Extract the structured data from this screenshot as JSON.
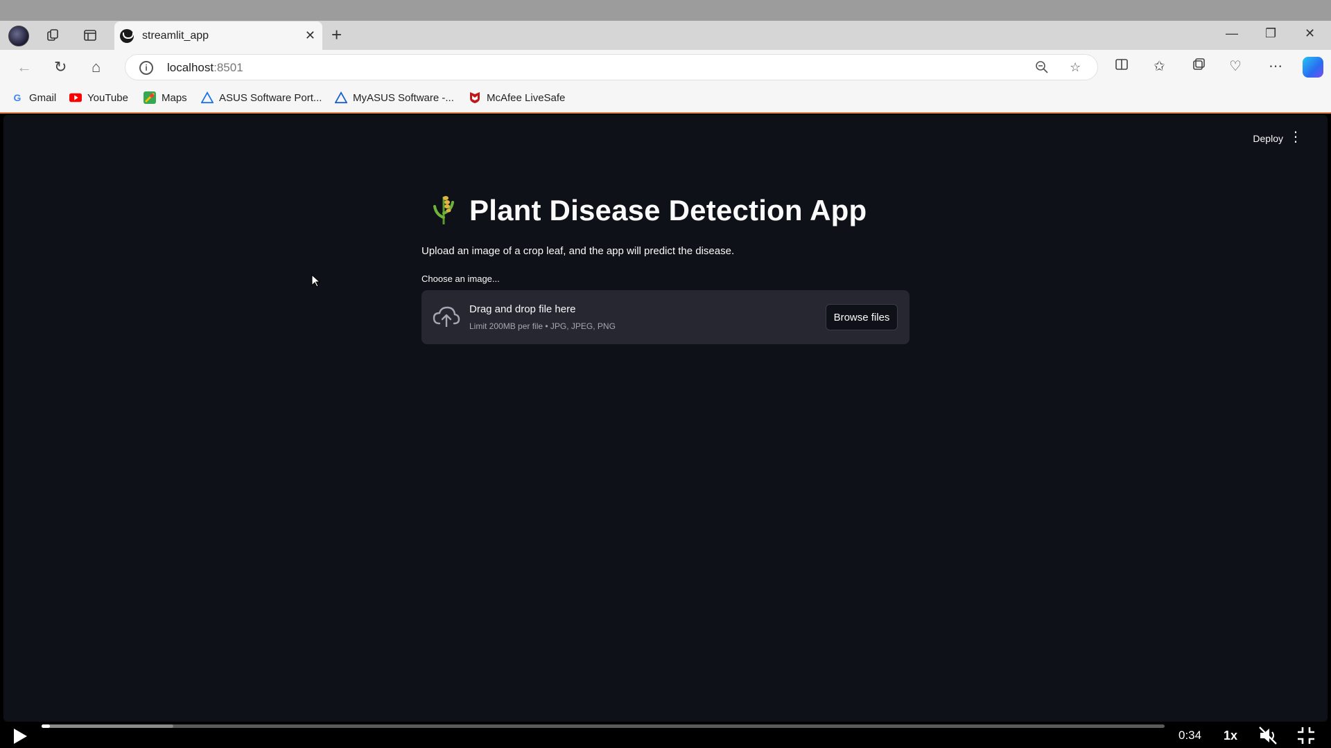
{
  "browser": {
    "tab_title": "streamlit_app",
    "url_host": "localhost",
    "url_port": ":8501",
    "bookmarks": [
      {
        "label": "Gmail",
        "icon": "google-icon"
      },
      {
        "label": "YouTube",
        "icon": "youtube-icon"
      },
      {
        "label": "Maps",
        "icon": "maps-icon"
      },
      {
        "label": "ASUS Software Port...",
        "icon": "asus-icon"
      },
      {
        "label": "MyASUS Software -...",
        "icon": "myasus-icon"
      },
      {
        "label": "McAfee LiveSafe",
        "icon": "mcafee-icon"
      }
    ]
  },
  "app": {
    "deploy_label": "Deploy",
    "title": "Plant Disease Detection App",
    "subtitle": "Upload an image of a crop leaf, and the app will predict the disease.",
    "uploader": {
      "label": "Choose an image...",
      "drag_text": "Drag and drop file here",
      "limit_text": "Limit 200MB per file • JPG, JPEG, PNG",
      "browse_label": "Browse files"
    },
    "colors": {
      "background": "#0e1117",
      "dropzone": "#262730",
      "text": "#fafafa"
    }
  },
  "player": {
    "time": "0:34",
    "speed": "1x",
    "progress": 0.005
  }
}
